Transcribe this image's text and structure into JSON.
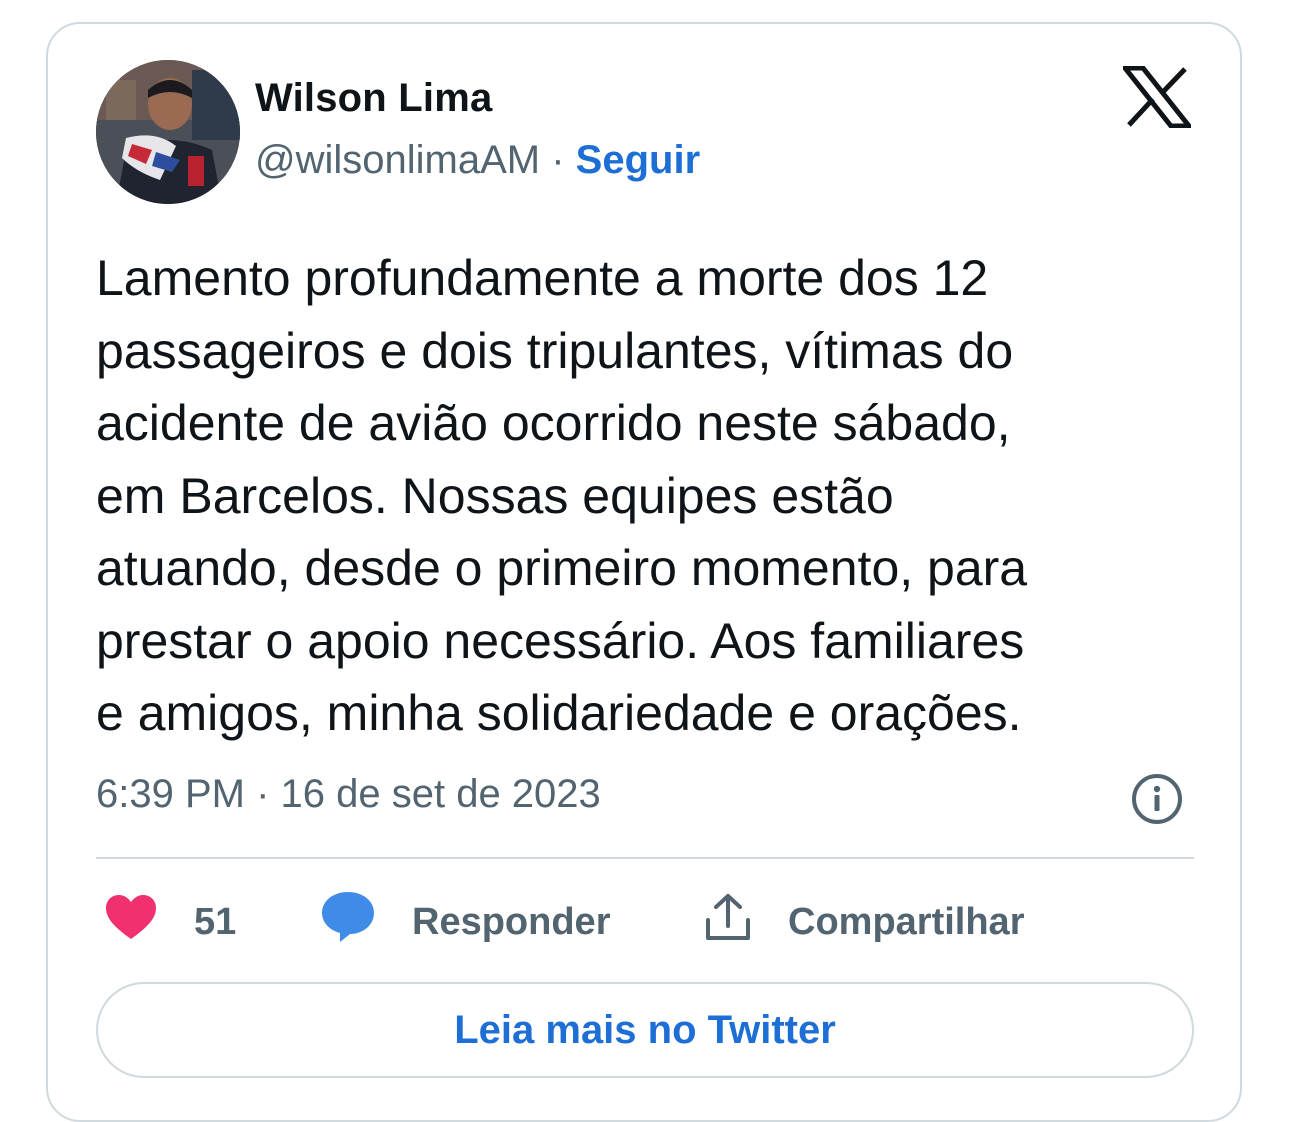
{
  "author": {
    "name": "Wilson Lima",
    "handle": "@wilsonlimaAM",
    "separator": " · ",
    "follow_label": "Seguir",
    "avatar_icon": "profile-photo"
  },
  "platform_icon": "x-logo-icon",
  "tweet": {
    "lines": [
      "Lamento profundamente a morte dos 12",
      "passageiros e dois tripulantes, vítimas do",
      "acidente de avião ocorrido neste sábado,",
      "em Barcelos. Nossas equipes estão",
      "atuando, desde o primeiro momento, para",
      "prestar o apoio necessário. Aos familiares",
      "e amigos, minha solidariedade e orações."
    ],
    "timestamp": "6:39 PM · 16 de set de 2023"
  },
  "actions": {
    "likes": "51",
    "reply_label": "Responder",
    "share_label": "Compartilhar"
  },
  "read_more_label": "Leia mais no Twitter",
  "colors": {
    "link_blue": "#1d6fd6",
    "heart_pink": "#f0306f",
    "reply_blue": "#3f8be8",
    "muted": "#536471",
    "border": "#cfd9de"
  }
}
